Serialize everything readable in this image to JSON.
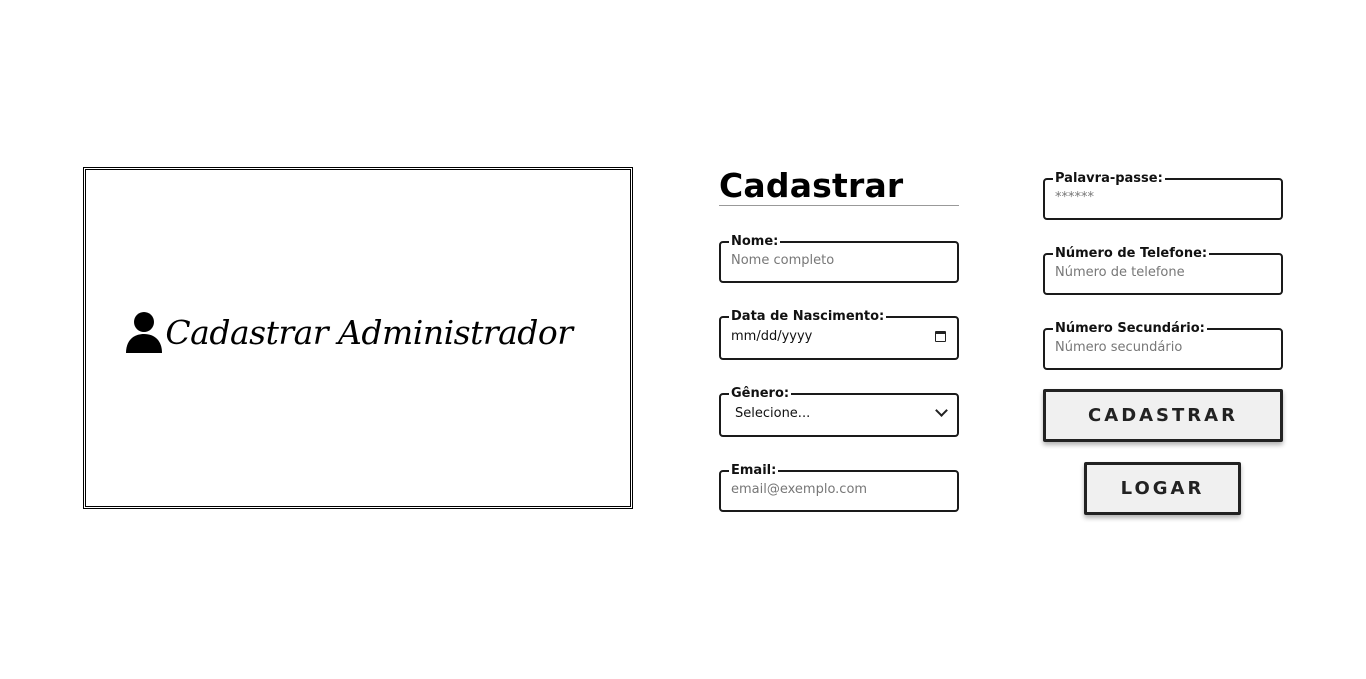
{
  "banner": {
    "icon": "user-icon",
    "title": "Cadastrar Administrador"
  },
  "form": {
    "title": "Cadastrar",
    "fields": {
      "nome": {
        "label": "Nome:",
        "placeholder": "Nome completo"
      },
      "nascimento": {
        "label": "Data de Nascimento:",
        "value": "mm/dd/yyyy"
      },
      "genero": {
        "label": "Gênero:",
        "selected": "Selecione..."
      },
      "email": {
        "label": "Email:",
        "placeholder": "email@exemplo.com"
      },
      "senha": {
        "label": "Palavra-passe:",
        "placeholder": "******"
      },
      "telefone": {
        "label": "Número de Telefone:",
        "placeholder": "Número de telefone"
      },
      "secundario": {
        "label": "Número Secundário:",
        "placeholder": "Número secundário"
      }
    },
    "buttons": {
      "cadastrar": "CADASTRAR",
      "logar": "LOGAR"
    }
  },
  "colors": {
    "border": "#1a1a1a",
    "button_bg": "#f0f0f0",
    "placeholder": "#777777"
  }
}
